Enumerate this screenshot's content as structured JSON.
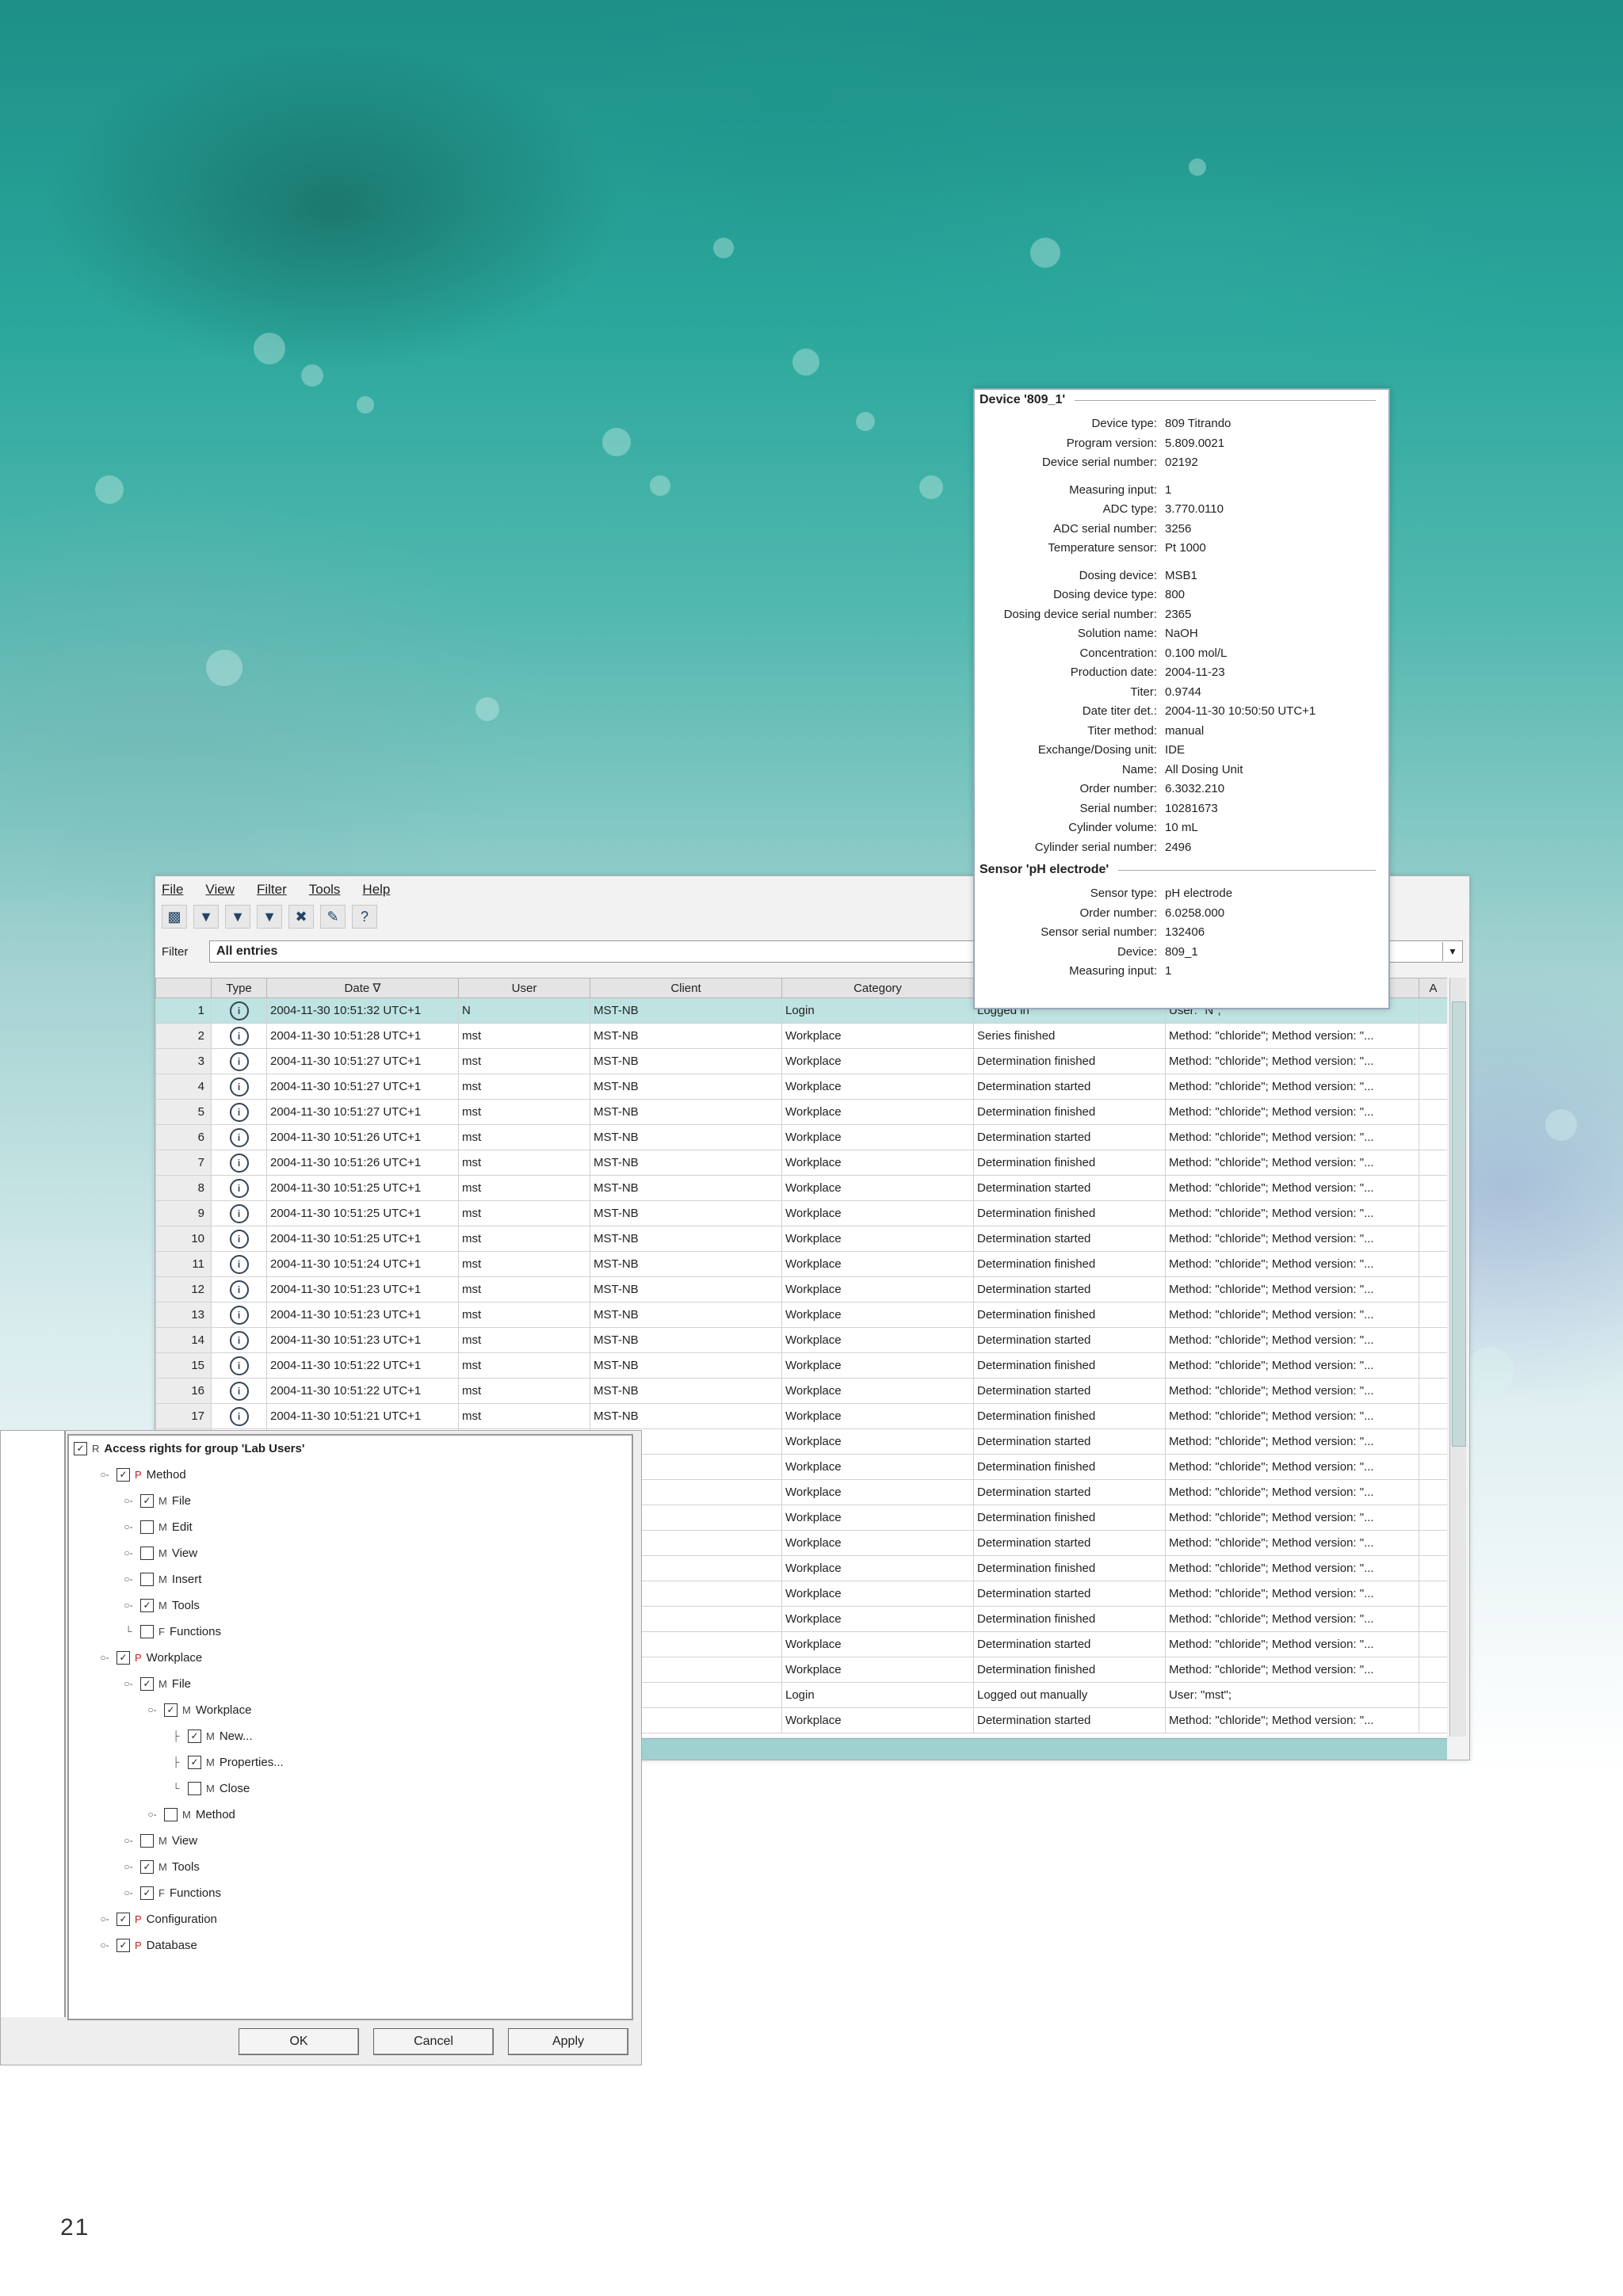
{
  "menu": [
    "File",
    "View",
    "Filter",
    "Tools",
    "Help"
  ],
  "toolbar_icons": [
    "save-icon",
    "filter-icon",
    "filter-icon",
    "filter-icon",
    "filter-remove-icon",
    "edit-icon",
    "help-icon"
  ],
  "filter": {
    "label": "Filter",
    "value": "All entries"
  },
  "columns": [
    "",
    "Type",
    "Date ∇",
    "User",
    "Client",
    "Category",
    "",
    "",
    "A"
  ],
  "rows": [
    [
      "1",
      "2004-11-30 10:51:32 UTC+1",
      "N",
      "MST-NB",
      "Login",
      "Logged in",
      "User: \"N\";"
    ],
    [
      "2",
      "2004-11-30 10:51:28 UTC+1",
      "mst",
      "MST-NB",
      "Workplace",
      "Series finished",
      "Method: \"chloride\"; Method version: \"..."
    ],
    [
      "3",
      "2004-11-30 10:51:27 UTC+1",
      "mst",
      "MST-NB",
      "Workplace",
      "Determination finished",
      "Method: \"chloride\"; Method version: \"..."
    ],
    [
      "4",
      "2004-11-30 10:51:27 UTC+1",
      "mst",
      "MST-NB",
      "Workplace",
      "Determination started",
      "Method: \"chloride\"; Method version: \"..."
    ],
    [
      "5",
      "2004-11-30 10:51:27 UTC+1",
      "mst",
      "MST-NB",
      "Workplace",
      "Determination finished",
      "Method: \"chloride\"; Method version: \"..."
    ],
    [
      "6",
      "2004-11-30 10:51:26 UTC+1",
      "mst",
      "MST-NB",
      "Workplace",
      "Determination started",
      "Method: \"chloride\"; Method version: \"..."
    ],
    [
      "7",
      "2004-11-30 10:51:26 UTC+1",
      "mst",
      "MST-NB",
      "Workplace",
      "Determination finished",
      "Method: \"chloride\"; Method version: \"..."
    ],
    [
      "8",
      "2004-11-30 10:51:25 UTC+1",
      "mst",
      "MST-NB",
      "Workplace",
      "Determination started",
      "Method: \"chloride\"; Method version: \"..."
    ],
    [
      "9",
      "2004-11-30 10:51:25 UTC+1",
      "mst",
      "MST-NB",
      "Workplace",
      "Determination finished",
      "Method: \"chloride\"; Method version: \"..."
    ],
    [
      "10",
      "2004-11-30 10:51:25 UTC+1",
      "mst",
      "MST-NB",
      "Workplace",
      "Determination started",
      "Method: \"chloride\"; Method version: \"..."
    ],
    [
      "11",
      "2004-11-30 10:51:24 UTC+1",
      "mst",
      "MST-NB",
      "Workplace",
      "Determination finished",
      "Method: \"chloride\"; Method version: \"..."
    ],
    [
      "12",
      "2004-11-30 10:51:23 UTC+1",
      "mst",
      "MST-NB",
      "Workplace",
      "Determination started",
      "Method: \"chloride\"; Method version: \"..."
    ],
    [
      "13",
      "2004-11-30 10:51:23 UTC+1",
      "mst",
      "MST-NB",
      "Workplace",
      "Determination finished",
      "Method: \"chloride\"; Method version: \"..."
    ],
    [
      "14",
      "2004-11-30 10:51:23 UTC+1",
      "mst",
      "MST-NB",
      "Workplace",
      "Determination started",
      "Method: \"chloride\"; Method version: \"..."
    ],
    [
      "15",
      "2004-11-30 10:51:22 UTC+1",
      "mst",
      "MST-NB",
      "Workplace",
      "Determination finished",
      "Method: \"chloride\"; Method version: \"..."
    ],
    [
      "16",
      "2004-11-30 10:51:22 UTC+1",
      "mst",
      "MST-NB",
      "Workplace",
      "Determination started",
      "Method: \"chloride\"; Method version: \"..."
    ],
    [
      "17",
      "2004-11-30 10:51:21 UTC+1",
      "mst",
      "MST-NB",
      "Workplace",
      "Determination finished",
      "Method: \"chloride\"; Method version: \"..."
    ],
    [
      "",
      "",
      "",
      "",
      "Workplace",
      "Determination started",
      "Method: \"chloride\"; Method version: \"..."
    ],
    [
      "",
      "",
      "",
      "",
      "Workplace",
      "Determination finished",
      "Method: \"chloride\"; Method version: \"..."
    ],
    [
      "",
      "",
      "",
      "",
      "Workplace",
      "Determination started",
      "Method: \"chloride\"; Method version: \"..."
    ],
    [
      "",
      "",
      "",
      "",
      "Workplace",
      "Determination finished",
      "Method: \"chloride\"; Method version: \"..."
    ],
    [
      "",
      "",
      "",
      "",
      "Workplace",
      "Determination started",
      "Method: \"chloride\"; Method version: \"..."
    ],
    [
      "",
      "",
      "",
      "",
      "Workplace",
      "Determination finished",
      "Method: \"chloride\"; Method version: \"..."
    ],
    [
      "",
      "",
      "",
      "",
      "Workplace",
      "Determination started",
      "Method: \"chloride\"; Method version: \"..."
    ],
    [
      "",
      "",
      "",
      "",
      "Workplace",
      "Determination finished",
      "Method: \"chloride\"; Method version: \"..."
    ],
    [
      "",
      "",
      "",
      "",
      "Workplace",
      "Determination started",
      "Method: \"chloride\"; Method version: \"..."
    ],
    [
      "",
      "",
      "",
      "",
      "Workplace",
      "Determination finished",
      "Method: \"chloride\"; Method version: \"..."
    ],
    [
      "",
      "",
      "",
      "",
      "Login",
      "Logged out manually",
      "User: \"mst\";"
    ],
    [
      "",
      "",
      "",
      "",
      "Workplace",
      "Determination started",
      "Method: \"chloride\"; Method version: \"..."
    ]
  ],
  "device": {
    "title": "Device '809_1'",
    "fields": [
      [
        "Device type:",
        "809 Titrando"
      ],
      [
        "Program version:",
        "5.809.0021"
      ],
      [
        "Device serial number:",
        "02192"
      ],
      [
        "Measuring input:",
        "1"
      ],
      [
        "ADC type:",
        "3.770.0110"
      ],
      [
        "ADC serial number:",
        "3256"
      ],
      [
        "Temperature sensor:",
        "Pt 1000"
      ],
      [
        "Dosing device:",
        "MSB1"
      ],
      [
        "Dosing device type:",
        "800"
      ],
      [
        "Dosing device serial number:",
        "2365"
      ],
      [
        "Solution name:",
        "NaOH"
      ],
      [
        "Concentration:",
        "0.100 mol/L"
      ],
      [
        "Production date:",
        "2004-11-23"
      ],
      [
        "Titer:",
        "0.9744"
      ],
      [
        "Date titer det.:",
        "2004-11-30 10:50:50 UTC+1"
      ],
      [
        "Titer method:",
        "manual"
      ],
      [
        "Exchange/Dosing unit:",
        "IDE"
      ],
      [
        "Name:",
        "All Dosing Unit"
      ],
      [
        "Order number:",
        "6.3032.210"
      ],
      [
        "Serial number:",
        "10281673"
      ],
      [
        "Cylinder volume:",
        "10 mL"
      ],
      [
        "Cylinder serial number:",
        "2496"
      ]
    ],
    "sensor_title": "Sensor 'pH electrode'",
    "sensor_fields": [
      [
        "Sensor type:",
        "pH electrode"
      ],
      [
        "Order number:",
        "6.0258.000"
      ],
      [
        "Sensor serial number:",
        "132406"
      ],
      [
        "Device:",
        "809_1"
      ],
      [
        "Measuring input:",
        "1"
      ]
    ]
  },
  "access": {
    "title": "Access rights for group 'Lab Users'",
    "title_tag": "R",
    "tree": [
      {
        "level": 0,
        "exp": "",
        "checked": true,
        "tag": "R",
        "label": "Access rights for group 'Lab Users'"
      },
      {
        "level": 1,
        "exp": "○-",
        "checked": true,
        "tag": "P",
        "label": "Method"
      },
      {
        "level": 2,
        "exp": "○-",
        "checked": true,
        "tag": "M",
        "label": "File"
      },
      {
        "level": 2,
        "exp": "○-",
        "checked": false,
        "tag": "M",
        "label": "Edit"
      },
      {
        "level": 2,
        "exp": "○-",
        "checked": false,
        "tag": "M",
        "label": "View"
      },
      {
        "level": 2,
        "exp": "○-",
        "checked": false,
        "tag": "M",
        "label": "Insert"
      },
      {
        "level": 2,
        "exp": "○-",
        "checked": true,
        "tag": "M",
        "label": "Tools"
      },
      {
        "level": 2,
        "exp": "└",
        "checked": false,
        "tag": "F",
        "label": "Functions"
      },
      {
        "level": 1,
        "exp": "○-",
        "checked": true,
        "tag": "P",
        "label": "Workplace"
      },
      {
        "level": 2,
        "exp": "○-",
        "checked": true,
        "tag": "M",
        "label": "File"
      },
      {
        "level": 3,
        "exp": "○-",
        "checked": true,
        "tag": "M",
        "label": "Workplace"
      },
      {
        "level": 4,
        "exp": "├",
        "checked": true,
        "tag": "M",
        "label": "New..."
      },
      {
        "level": 4,
        "exp": "├",
        "checked": true,
        "tag": "M",
        "label": "Properties..."
      },
      {
        "level": 4,
        "exp": "└",
        "checked": false,
        "tag": "M",
        "label": "Close"
      },
      {
        "level": 3,
        "exp": "○-",
        "checked": false,
        "tag": "M",
        "label": "Method"
      },
      {
        "level": 2,
        "exp": "○-",
        "checked": false,
        "tag": "M",
        "label": "View"
      },
      {
        "level": 2,
        "exp": "○-",
        "checked": true,
        "tag": "M",
        "label": "Tools"
      },
      {
        "level": 2,
        "exp": "○-",
        "checked": true,
        "tag": "F",
        "label": "Functions"
      },
      {
        "level": 1,
        "exp": "○-",
        "checked": true,
        "tag": "P",
        "label": "Configuration"
      },
      {
        "level": 1,
        "exp": "○-",
        "checked": true,
        "tag": "P",
        "label": "Database"
      }
    ],
    "buttons": {
      "ok": "OK",
      "cancel": "Cancel",
      "apply": "Apply"
    }
  },
  "page_number": "21"
}
